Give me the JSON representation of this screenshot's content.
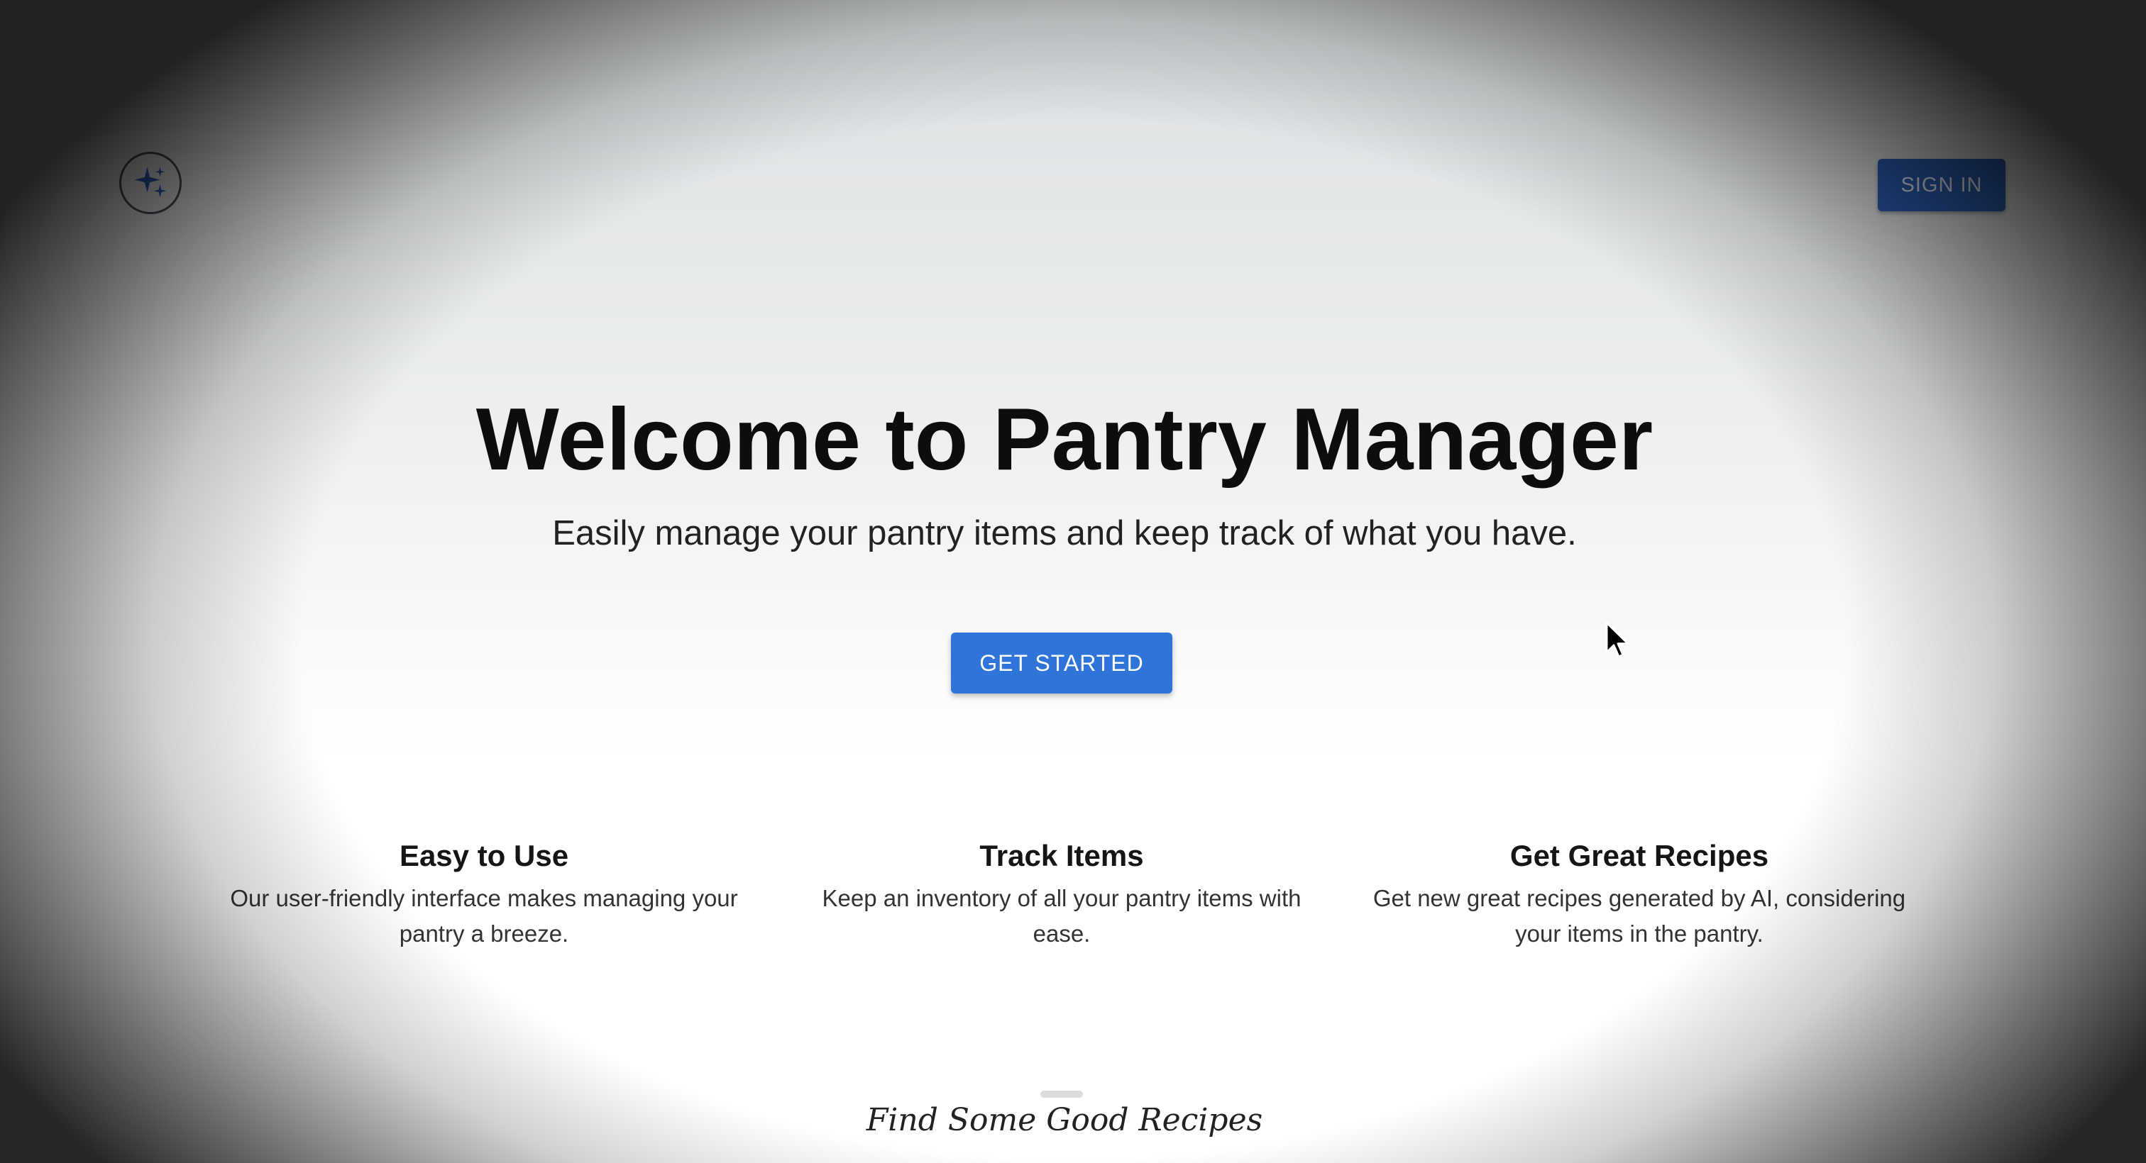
{
  "header": {
    "logo_icon": "sparkles-icon",
    "signin_label": "SIGN IN"
  },
  "hero": {
    "title": "Welcome to Pantry Manager",
    "subtitle": "Easily manage your pantry items and keep track of what you have.",
    "cta_label": "GET STARTED"
  },
  "features": [
    {
      "title": "Easy to Use",
      "description": "Our user-friendly interface makes managing your pantry a breeze."
    },
    {
      "title": "Track Items",
      "description": "Keep an inventory of all your pantry items with ease."
    },
    {
      "title": "Get Great Recipes",
      "description": "Get new great recipes generated by AI, considering your items in the pantry."
    }
  ],
  "recipes_section": {
    "heading": "Find Some Good Recipes"
  },
  "colors": {
    "signin_bg": "#2d5fb6",
    "cta_bg": "#2f74d9",
    "logo_accent": "#2d5fb6"
  }
}
